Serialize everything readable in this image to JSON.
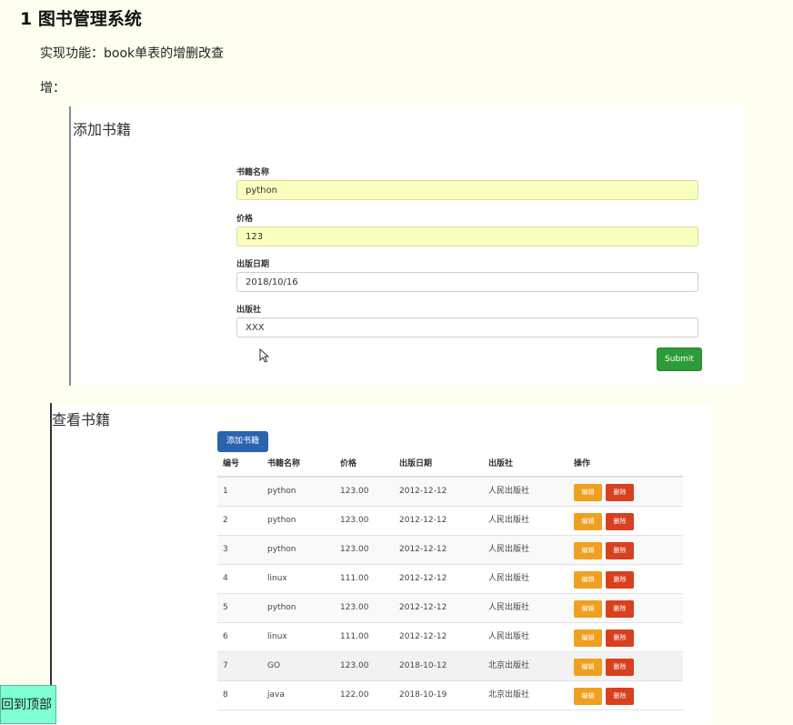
{
  "heading": "1 图书管理系统",
  "intro": "实现功能：book单表的增删改查",
  "add_label": "增：",
  "form": {
    "title": "添加书籍",
    "fields": [
      {
        "label": "书籍名称",
        "value": "python"
      },
      {
        "label": "价格",
        "value": "123"
      },
      {
        "label": "出版日期",
        "value": "2018/10/16"
      },
      {
        "label": "出版社",
        "value": "XXX"
      }
    ],
    "submit": "Submit"
  },
  "list": {
    "title": "查看书籍",
    "add_button": "添加书籍",
    "columns": [
      "编号",
      "书籍名称",
      "价格",
      "出版日期",
      "出版社",
      "操作"
    ],
    "edit_label": "编辑",
    "delete_label": "删除",
    "rows": [
      {
        "id": "1",
        "name": "python",
        "price": "123.00",
        "date": "2012-12-12",
        "press": "人民出版社"
      },
      {
        "id": "2",
        "name": "python",
        "price": "123.00",
        "date": "2012-12-12",
        "press": "人民出版社"
      },
      {
        "id": "3",
        "name": "python",
        "price": "123.00",
        "date": "2012-12-12",
        "press": "人民出版社"
      },
      {
        "id": "4",
        "name": "linux",
        "price": "111.00",
        "date": "2012-12-12",
        "press": "人民出版社"
      },
      {
        "id": "5",
        "name": "python",
        "price": "123.00",
        "date": "2012-12-12",
        "press": "人民出版社"
      },
      {
        "id": "6",
        "name": "linux",
        "price": "111.00",
        "date": "2012-12-12",
        "press": "人民出版社"
      },
      {
        "id": "7",
        "name": "GO",
        "price": "123.00",
        "date": "2018-10-12",
        "press": "北京出版社"
      },
      {
        "id": "8",
        "name": "java",
        "price": "122.00",
        "date": "2018-10-19",
        "press": "北京出版社"
      }
    ]
  },
  "back_to_top": "回到顶部",
  "colors": {
    "page_bg": "#fffff0",
    "submit": "#2e9b3a",
    "primary": "#2a64b0",
    "edit": "#f0a020",
    "delete": "#d9401f",
    "autofill": "#faffbd",
    "to_top": "#7fffd4"
  },
  "icons": {
    "cursor": "mouse-pointer-icon"
  }
}
